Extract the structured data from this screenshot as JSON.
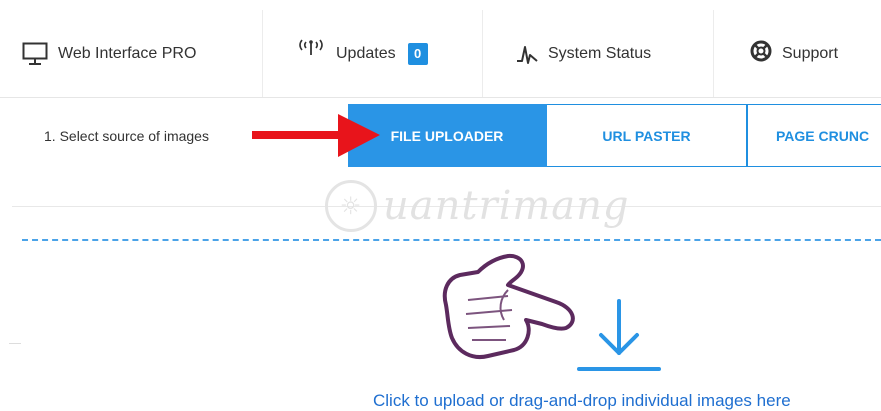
{
  "nav": {
    "items": [
      {
        "label": "Web Interface PRO",
        "icon": "monitor-icon"
      },
      {
        "label": "Updates",
        "icon": "antenna-icon",
        "badge": "0"
      },
      {
        "label": "System Status",
        "icon": "pulse-icon"
      },
      {
        "label": "Support",
        "icon": "lifebuoy-icon"
      }
    ]
  },
  "source": {
    "label": "1. Select source of images",
    "tabs": [
      {
        "label": "FILE UPLOADER",
        "active": true
      },
      {
        "label": "URL PASTER",
        "active": false
      },
      {
        "label": "PAGE CRUNC",
        "active": false
      }
    ]
  },
  "watermark": {
    "text": "uantrimang"
  },
  "upload": {
    "text": "Click to upload or drag-and-drop individual images here"
  },
  "colors": {
    "accent": "#2a95e6",
    "arrow": "#e8141b",
    "hand": "#5c2a5e",
    "link": "#1f6fd0"
  }
}
